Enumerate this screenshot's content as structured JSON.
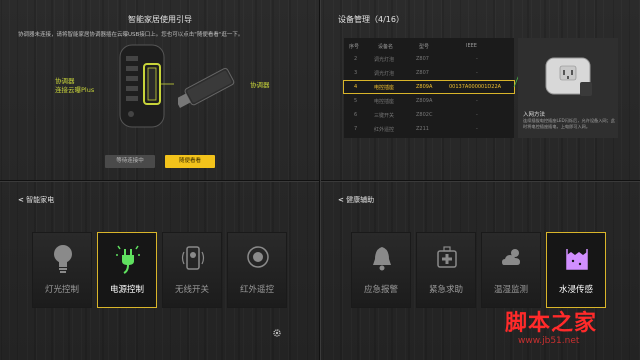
{
  "guide": {
    "title": "智能家居使用引导",
    "message": "协调器未连接，请将智能家居协调器插在云曝USB接口上。您也可以点击\"随便看看\"逛一下。",
    "hub_label_line1": "协调器",
    "hub_label_line2": "连接云曝Plus",
    "dongle_label": "协调器",
    "wait_button": "等待连接中",
    "browse_button": "随便看看"
  },
  "device_manager": {
    "title": "设备管理（4/16）",
    "columns": [
      "序号",
      "设备名",
      "型号",
      "IEEE"
    ],
    "rows": [
      {
        "no": "2",
        "name": "调光灯泡",
        "model": "Z807",
        "ieee": "-"
      },
      {
        "no": "3",
        "name": "调光灯泡",
        "model": "Z807",
        "ieee": "-"
      },
      {
        "no": "4",
        "name": "电控插座",
        "model": "Z809A",
        "ieee": "00137A000001D22A"
      },
      {
        "no": "5",
        "name": "电控插座",
        "model": "Z809A",
        "ieee": "-"
      },
      {
        "no": "6",
        "name": "三键开关",
        "model": "Z802C",
        "ieee": "-"
      },
      {
        "no": "7",
        "name": "红外遥控",
        "model": "Z211",
        "ieee": "-"
      }
    ],
    "selected_index": 2,
    "detail_title": "入网方法",
    "detail_desc": "连续插拔电控插座LED闪烁后，允许设备入网；此时将电控插座插电，上电即可入网。"
  },
  "smart_appliance": {
    "header": "智能家电",
    "tiles": [
      {
        "label": "灯光控制",
        "icon": "bulb-icon"
      },
      {
        "label": "电源控制",
        "icon": "plug-icon"
      },
      {
        "label": "无线开关",
        "icon": "wireless-switch-icon"
      },
      {
        "label": "红外遥控",
        "icon": "ir-remote-icon"
      }
    ]
  },
  "health_assist": {
    "header": "健康辅助",
    "tiles": [
      {
        "label": "应急报警",
        "icon": "alarm-bell-icon"
      },
      {
        "label": "紧急求助",
        "icon": "first-aid-icon"
      },
      {
        "label": "温湿监测",
        "icon": "weather-icon"
      },
      {
        "label": "水浸传感",
        "icon": "water-sensor-icon"
      }
    ]
  },
  "watermark": {
    "text": "脚本之家",
    "url": "www.jb51.net"
  },
  "colors": {
    "accent": "#f3c31b",
    "highlight_border": "#d9b52a",
    "label_yellow": "#c8d43a"
  }
}
